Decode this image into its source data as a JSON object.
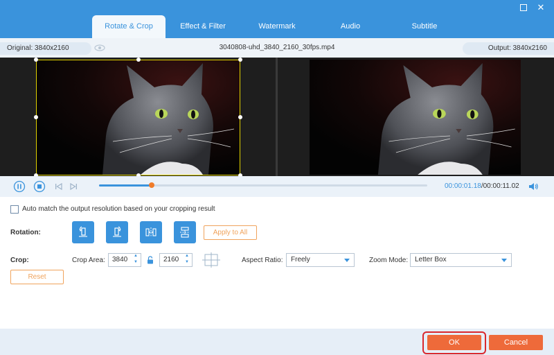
{
  "window": {
    "maximize_icon": "maximize-icon",
    "close_icon": "close-icon",
    "close_glyph": "✕"
  },
  "tabs": [
    {
      "label": "Rotate & Crop",
      "active": true
    },
    {
      "label": "Effect & Filter",
      "active": false
    },
    {
      "label": "Watermark",
      "active": false
    },
    {
      "label": "Audio",
      "active": false
    },
    {
      "label": "Subtitle",
      "active": false
    }
  ],
  "info": {
    "original": "Original: 3840x2160",
    "filename": "3040808-uhd_3840_2160_30fps.mp4",
    "output": "Output: 3840x2160"
  },
  "player": {
    "current_time": "00:00:01.18",
    "duration": "/00:00:11.02",
    "progress": 0.16
  },
  "options": {
    "auto_match_label": "Auto match the output resolution based on your cropping result",
    "auto_match_checked": false,
    "rotation_label": "Rotation:",
    "apply_all_label": "Apply to All",
    "crop_label": "Crop:",
    "crop_area_label": "Crop Area:",
    "crop_width": "3840",
    "crop_height": "2160",
    "aspect_ratio_label": "Aspect Ratio:",
    "aspect_ratio_value": "Freely",
    "zoom_mode_label": "Zoom Mode:",
    "zoom_mode_value": "Letter Box",
    "reset_label": "Reset"
  },
  "footer": {
    "ok_label": "OK",
    "cancel_label": "Cancel"
  },
  "colors": {
    "accent": "#3a93dc",
    "orange": "#ee6a3a",
    "highlight_red": "#d9272d",
    "crop_box": "#e3d400"
  }
}
